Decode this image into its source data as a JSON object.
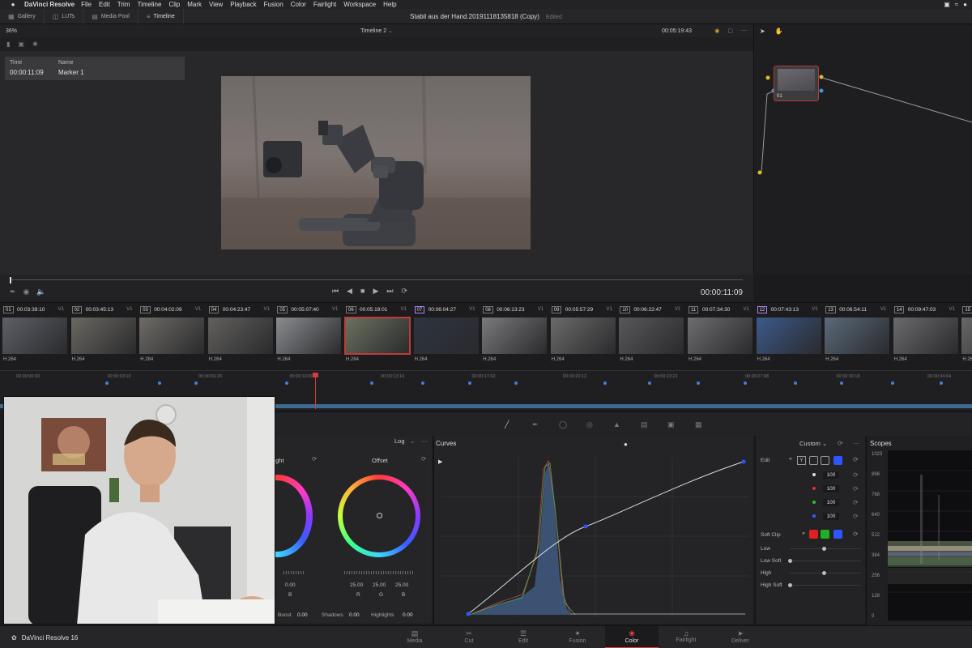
{
  "menubar": {
    "app": "DaVinci Resolve",
    "items": [
      "File",
      "Edit",
      "Trim",
      "Timeline",
      "Clip",
      "Mark",
      "View",
      "Playback",
      "Fusion",
      "Color",
      "Fairlight",
      "Workspace",
      "Help"
    ]
  },
  "toolbar": {
    "gallery": "Gallery",
    "luts": "LUTs",
    "media_pool": "Media Pool",
    "timeline": "Timeline",
    "title": "Stabil aus der Hand.20191118135818 (Copy)",
    "status": "Edited"
  },
  "viewer": {
    "zoom": "36%",
    "timeline_name": "Timeline 2",
    "timecode": "00:05:19:43",
    "marker_headers": [
      "Time",
      "Name"
    ],
    "marker_time": "00:00:11:09",
    "marker_name": "Marker 1",
    "current_tc": "00:00:11:09"
  },
  "node": {
    "label": "01"
  },
  "clips": [
    {
      "num": "01",
      "tc": "00:03:39:10",
      "trk": "V1",
      "codec": "H.264",
      "color": "#5d6068"
    },
    {
      "num": "02",
      "tc": "00:03:45:13",
      "trk": "V1",
      "codec": "H.264",
      "color": "#6a6862"
    },
    {
      "num": "03",
      "tc": "00:04:02:09",
      "trk": "V1",
      "codec": "H.264",
      "color": "#6e6b67"
    },
    {
      "num": "04",
      "tc": "00:04:23:47",
      "trk": "V1",
      "codec": "H.264",
      "color": "#62605e"
    },
    {
      "num": "05",
      "tc": "00:05:07:40",
      "trk": "V1",
      "codec": "H.264",
      "color": "#8a8c90"
    },
    {
      "num": "06",
      "tc": "00:05:19:01",
      "trk": "V1",
      "codec": "H.264",
      "color": "#6b7260",
      "active": true
    },
    {
      "num": "07",
      "tc": "00:06:04:27",
      "trk": "V1",
      "codec": "H.264",
      "color": "#2d3440",
      "sel": true
    },
    {
      "num": "08",
      "tc": "00:06:13:23",
      "trk": "V1",
      "codec": "H.264",
      "color": "#7a7a7c"
    },
    {
      "num": "09",
      "tc": "00:05:57:29",
      "trk": "V1",
      "codec": "H.264",
      "color": "#6c6a6a"
    },
    {
      "num": "10",
      "tc": "00:06:22:47",
      "trk": "V1",
      "codec": "H.264",
      "color": "#58585c"
    },
    {
      "num": "11",
      "tc": "00:07:34:30",
      "trk": "V1",
      "codec": "H.264",
      "color": "#6d6d70"
    },
    {
      "num": "12",
      "tc": "00:07:43:13",
      "trk": "V1",
      "codec": "H.264",
      "color": "#3b5a8a",
      "sel": true
    },
    {
      "num": "13",
      "tc": "00:06:54:11",
      "trk": "V1",
      "codec": "H.264",
      "color": "#5a6a7a"
    },
    {
      "num": "14",
      "tc": "00:09:47:03",
      "trk": "V1",
      "codec": "H.264",
      "color": "#6a6a6e"
    },
    {
      "num": "15",
      "tc": "",
      "trk": "",
      "codec": "H.264",
      "color": "#686868"
    }
  ],
  "ruler": [
    "00:00:00:00",
    "00:00:03:10",
    "00:00:06:20",
    "00:00:10:00",
    "00:00:13:16",
    "00:00:17:02",
    "00:00:20:12",
    "00:00:23:22",
    "00:00:27:08",
    "00:00:30:18",
    "00:00:34:04"
  ],
  "wheels": {
    "mode": "Log",
    "label_a": "ght",
    "label_b": "Offset",
    "val_a": "0.00",
    "chan_a": "B",
    "offset_vals": [
      "25.00",
      "25.00",
      "25.00"
    ],
    "offset_chans": [
      "R",
      "G",
      "B"
    ],
    "footer": {
      "boost_lbl": "Boost",
      "boost": "0.00",
      "shadows_lbl": "Shadows",
      "shadows": "0.00",
      "highlights_lbl": "Highlights",
      "highlights": "0.00"
    }
  },
  "curves": {
    "title": "Curves",
    "mode": "Custom"
  },
  "edit_panel": {
    "edit": "Edit",
    "vals": [
      "100",
      "100",
      "100",
      "100"
    ],
    "softclip": "Soft Clip",
    "low": "Low",
    "low_soft": "Low Soft",
    "high": "High",
    "high_soft": "High Soft",
    "y": "Y"
  },
  "scopes": {
    "title": "Scopes",
    "labels": [
      "1023",
      "896",
      "768",
      "640",
      "512",
      "384",
      "256",
      "128",
      "0"
    ]
  },
  "footer": {
    "brand": "DaVinci Resolve 16",
    "tabs": [
      "Media",
      "Cut",
      "Edit",
      "Fusion",
      "Color",
      "Fairlight",
      "Deliver"
    ],
    "active": "Color"
  },
  "colors": {
    "accent": "#e23b3b",
    "marker": "#3f82e0",
    "node_border": "#b23a3a"
  }
}
